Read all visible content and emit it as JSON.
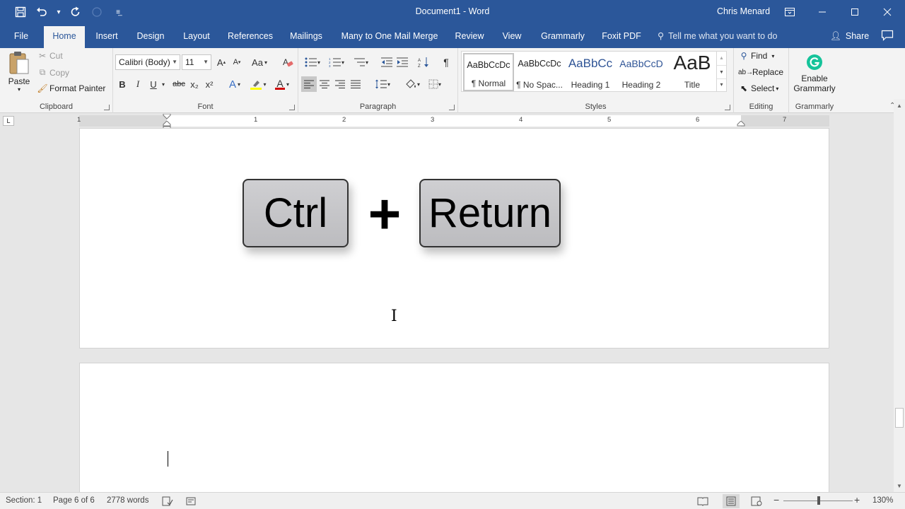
{
  "window": {
    "title": "Document1  -  Word",
    "user": "Chris Menard",
    "qat": {
      "save_icon": "save-icon",
      "undo_icon": "undo-icon",
      "redo_icon": "redo-icon",
      "customize_icon": "customize-qat-icon"
    }
  },
  "tabs": [
    {
      "label": "File"
    },
    {
      "label": "Home"
    },
    {
      "label": "Insert"
    },
    {
      "label": "Design"
    },
    {
      "label": "Layout"
    },
    {
      "label": "References"
    },
    {
      "label": "Mailings"
    },
    {
      "label": "Many to One Mail Merge"
    },
    {
      "label": "Review"
    },
    {
      "label": "View"
    },
    {
      "label": "Grammarly"
    },
    {
      "label": "Foxit PDF"
    }
  ],
  "tell_me": "Tell me what you want to do",
  "share": "Share",
  "clipboard": {
    "label": "Clipboard",
    "paste": "Paste",
    "cut": "Cut",
    "copy": "Copy",
    "format_painter": "Format Painter"
  },
  "font": {
    "label": "Font",
    "font_name": "Calibri (Body)",
    "font_size": "11",
    "bold": "B",
    "italic": "I",
    "underline": "U",
    "strike": "abc",
    "subscript": "x₂",
    "superscript": "x²",
    "grow": "A",
    "shrink": "A",
    "case": "Aa",
    "text_effect": "A",
    "font_color": "A",
    "font_color_hex": "#d00000",
    "highlight_hex": "#ffff00"
  },
  "paragraph": {
    "label": "Paragraph",
    "pilcrow": "¶"
  },
  "styles": {
    "label": "Styles",
    "items": [
      {
        "preview": "AaBbCcDc",
        "name": "¶ Normal"
      },
      {
        "preview": "AaBbCcDc",
        "name": "¶ No Spac..."
      },
      {
        "preview": "AaBbCc",
        "name": "Heading 1"
      },
      {
        "preview": "AaBbCcD",
        "name": "Heading 2"
      },
      {
        "preview": "AaB",
        "name": "Title"
      }
    ],
    "heading_color": "#2f5496"
  },
  "editing": {
    "label": "Editing",
    "find": "Find",
    "replace": "Replace",
    "select": "Select"
  },
  "grammarly": {
    "label": "Grammarly",
    "enable_line1": "Enable",
    "enable_line2": "Grammarly",
    "brand_color": "#15c39a"
  },
  "ruler": {
    "numbers": [
      "1",
      "1",
      "2",
      "3",
      "4",
      "5",
      "6",
      "7"
    ],
    "tab_selector": "L"
  },
  "document": {
    "key_left": "Ctrl",
    "plus": "+",
    "key_right": "Return"
  },
  "status": {
    "section": "Section: 1",
    "page": "Page 6 of 6",
    "words": "2778 words",
    "zoom": "130%",
    "zoom_minus": "−",
    "zoom_plus": "+"
  },
  "theme": {
    "accent": "#2b579a"
  }
}
